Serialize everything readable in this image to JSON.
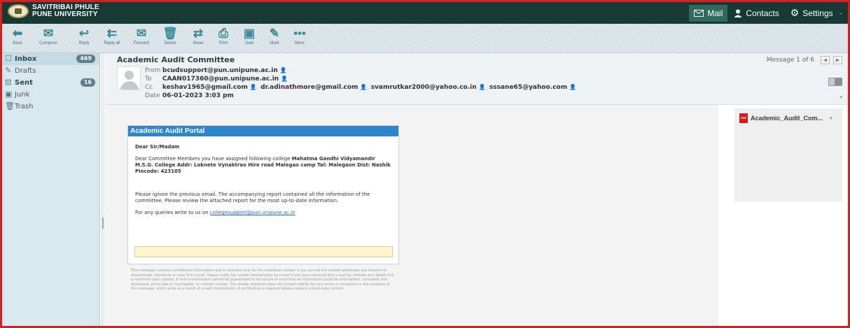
{
  "header": {
    "logo_line1": "SAVITRIBAI PHULE",
    "logo_line2": "PUNE UNIVERSITY",
    "nav": [
      {
        "label": "Mail",
        "icon": "mail-icon"
      },
      {
        "label": "Contacts",
        "icon": "person-icon"
      },
      {
        "label": "Settings",
        "icon": "gear-icon"
      }
    ]
  },
  "toolbar": {
    "back": "Back",
    "compose": "Compose",
    "reply": "Reply",
    "reply_all": "Reply all",
    "forward": "Forward",
    "delete": "Delete",
    "move": "Move",
    "print": "Print",
    "junk": "Junk",
    "mark": "Mark",
    "more": "More"
  },
  "sidebar": {
    "folders": [
      {
        "label": "Inbox",
        "badge": "469",
        "icon": "inbox-icon"
      },
      {
        "label": "Drafts",
        "badge": "",
        "icon": "pencil-icon"
      },
      {
        "label": "Sent",
        "badge": "16",
        "icon": "sent-icon"
      },
      {
        "label": "Junk",
        "badge": "",
        "icon": "junk-icon"
      },
      {
        "label": "Trash",
        "badge": "",
        "icon": "trash-icon"
      }
    ]
  },
  "message": {
    "subject": "Academic Audit Committee",
    "from_label": "From",
    "from": "bcudsupport@pun.unipune.ac.in",
    "to_label": "To",
    "to": "CAAN017360@pun.unipune.ac.in",
    "cc_label": "Cc",
    "cc": [
      "keshav1965@gmail.com",
      "dr.adinathmore@gmail.com",
      "svamrutkar2000@yahoo.co.in",
      "sssane65@yahoo.com"
    ],
    "date_label": "Date",
    "date": "06-01-2023 3:03 pm",
    "counter": "Message 1 of 6"
  },
  "mail_body": {
    "portal_title": "Academic Audit Portal",
    "greeting": "Dear Sir/Madam",
    "para1_lead": "Dear Committee Members you have assigned following college ",
    "para1_bold": "Mahatma Gandhi Vidyamandir M.S.G. College Addr: Loknete Vynaktrao Hire road Malegao camp Tal: Malegaon Dist: Nashik Pincode: 423105",
    "para2": "Please ignore the previous email. The accompanying report contained all the information of the committee. Please review the attached report for the most up-to-date information.",
    "para3_lead": "For any queries write to us on ",
    "para3_link": "collegesupport@pun.unipune.ac.in",
    "disclaimer": "This message contains confidential information and is intended only for the individual named. If you are not the named addressee you should not disseminate, distribute or copy this e-mail. Please notify the sender immediately by e-mail if you have received this e-mail by mistake and delete this e-mail from your system. E-mail transmission cannot be guaranteed to be secure or error-free as information could be intercepted, corrupted, lost, destroyed, arrive late or incomplete, or contain viruses. The sender therefore does not accept liability for any errors or omissions in the contents of this message, which arise as a result of e-mail transmission. If verification is required please request a hard-copy version."
  },
  "attachment": {
    "name": "Academic_Audit_Com...",
    "type_label": "PDF"
  },
  "colors": {
    "header_bg": "#163a33",
    "frame_border": "#d42020",
    "portal_blue": "#2d86cc",
    "sidebar_bg": "#d9e7ee"
  }
}
